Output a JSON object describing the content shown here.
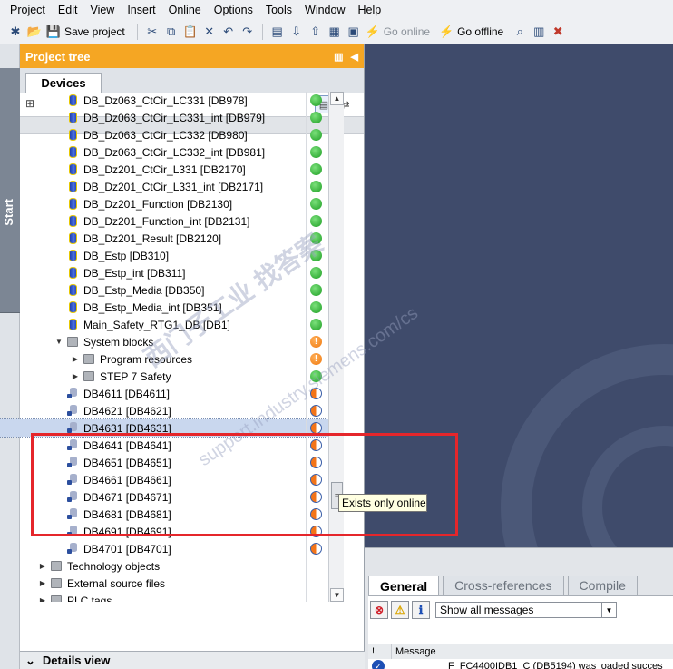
{
  "menu": [
    "Project",
    "Edit",
    "View",
    "Insert",
    "Online",
    "Options",
    "Tools",
    "Window",
    "Help"
  ],
  "toolbar": {
    "save_project": "Save project",
    "go_online": "Go online",
    "go_offline": "Go offline"
  },
  "start_strip": {
    "label": "Start"
  },
  "project_tree": {
    "title": "Project tree",
    "tab": "Devices",
    "items": [
      {
        "label": "DB_Dz063_CtCir_LC331 [DB978]",
        "icon": "db-icon",
        "status": "green",
        "indent": 1
      },
      {
        "label": "DB_Dz063_CtCir_LC331_int [DB979]",
        "icon": "db-icon",
        "status": "green",
        "indent": 1
      },
      {
        "label": "DB_Dz063_CtCir_LC332 [DB980]",
        "icon": "db-icon",
        "status": "green",
        "indent": 1
      },
      {
        "label": "DB_Dz063_CtCir_LC332_int [DB981]",
        "icon": "db-icon",
        "status": "green",
        "indent": 1
      },
      {
        "label": "DB_Dz201_CtCir_L331 [DB2170]",
        "icon": "db-icon",
        "status": "green",
        "indent": 1
      },
      {
        "label": "DB_Dz201_CtCir_L331_int [DB2171]",
        "icon": "db-icon",
        "status": "green",
        "indent": 1
      },
      {
        "label": "DB_Dz201_Function [DB2130]",
        "icon": "db-icon",
        "status": "green",
        "indent": 1
      },
      {
        "label": "DB_Dz201_Function_int [DB2131]",
        "icon": "db-icon",
        "status": "green",
        "indent": 1
      },
      {
        "label": "DB_Dz201_Result [DB2120]",
        "icon": "db-icon",
        "status": "green",
        "indent": 1
      },
      {
        "label": "DB_Estp [DB310]",
        "icon": "db-icon",
        "status": "green",
        "indent": 1
      },
      {
        "label": "DB_Estp_int [DB311]",
        "icon": "db-icon",
        "status": "green",
        "indent": 1
      },
      {
        "label": "DB_Estp_Media [DB350]",
        "icon": "db-icon",
        "status": "green",
        "indent": 1
      },
      {
        "label": "DB_Estp_Media_int [DB351]",
        "icon": "db-icon",
        "status": "green",
        "indent": 1
      },
      {
        "label": "Main_Safety_RTG1_DB [DB1]",
        "icon": "db-icon",
        "status": "green",
        "indent": 1
      },
      {
        "label": "System blocks",
        "icon": "folder-icon",
        "status": "orange",
        "indent": 1,
        "arrow": "down"
      },
      {
        "label": "Program resources",
        "icon": "folder-icon",
        "status": "orange",
        "indent": 2,
        "arrow": "right"
      },
      {
        "label": "STEP 7 Safety",
        "icon": "folder-icon",
        "status": "green",
        "indent": 2,
        "arrow": "right"
      },
      {
        "label": "DB4611 [DB4611]",
        "icon": "db-online-icon",
        "status": "half",
        "indent": 1
      },
      {
        "label": "DB4621 [DB4621]",
        "icon": "db-online-icon",
        "status": "half",
        "indent": 1
      },
      {
        "label": "DB4631 [DB4631]",
        "icon": "db-online-icon",
        "status": "half",
        "indent": 1,
        "selected": true
      },
      {
        "label": "DB4641 [DB4641]",
        "icon": "db-online-icon",
        "status": "half",
        "indent": 1
      },
      {
        "label": "DB4651 [DB4651]",
        "icon": "db-online-icon",
        "status": "half",
        "indent": 1
      },
      {
        "label": "DB4661 [DB4661]",
        "icon": "db-online-icon",
        "status": "half",
        "indent": 1
      },
      {
        "label": "DB4671 [DB4671]",
        "icon": "db-online-icon",
        "status": "half",
        "indent": 1
      },
      {
        "label": "DB4681 [DB4681]",
        "icon": "db-online-icon",
        "status": "half",
        "indent": 1
      },
      {
        "label": "DB4691 [DB4691]",
        "icon": "db-online-icon",
        "status": "half",
        "indent": 1
      },
      {
        "label": "DB4701 [DB4701]",
        "icon": "db-online-icon",
        "status": "half",
        "indent": 1
      },
      {
        "label": "Technology objects",
        "icon": "folder-icon",
        "status": "",
        "indent": 0,
        "arrow": "right"
      },
      {
        "label": "External source files",
        "icon": "folder-icon",
        "status": "",
        "indent": 0,
        "arrow": "right"
      },
      {
        "label": "PLC tags",
        "icon": "folder-icon",
        "status": "",
        "indent": 0,
        "arrow": "right"
      }
    ]
  },
  "tooltip": "Exists only online",
  "details_view": {
    "label": "Details view"
  },
  "inspector": {
    "tabs": [
      "General",
      "Cross-references",
      "Compile"
    ],
    "filter": {
      "selected": "Show all messages"
    },
    "columns": {
      "icon": "!",
      "message": "Message"
    },
    "message_row": "F_FC4400IDB1_C (DB5194) was loaded succes"
  },
  "watermark": {
    "line1": "找答案",
    "line2": "support.industry.siemens.com/cs",
    "line3": "西门子工业"
  },
  "colors": {
    "header_orange": "#f5a623",
    "work_area": "#3f4b6b",
    "highlight_red": "#e5262b",
    "status_green": "#1e9e24",
    "status_orange": "#f07a10"
  }
}
